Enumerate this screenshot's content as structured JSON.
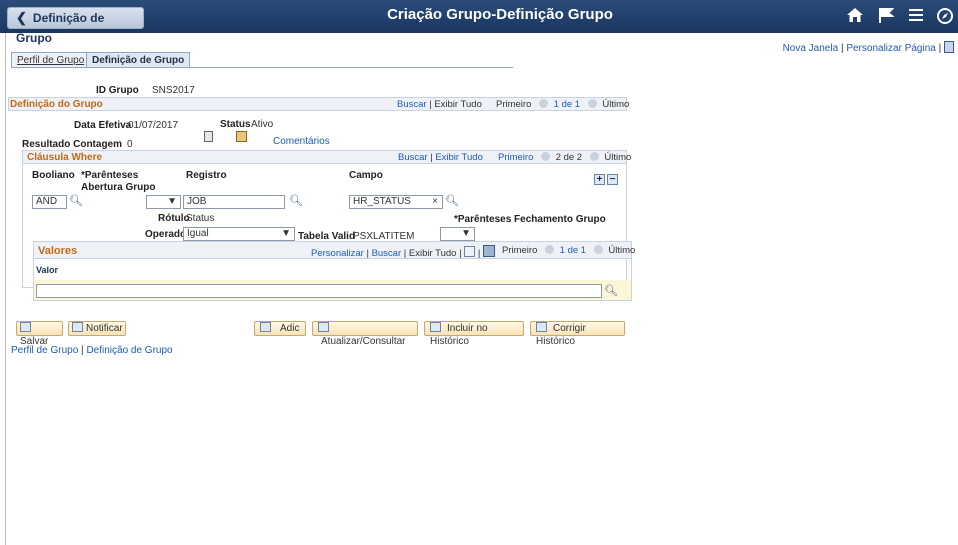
{
  "header": {
    "back_label": "Definição de Grupo",
    "title": "Criação Grupo-Definição Grupo",
    "icons": [
      "home-icon",
      "flag-icon",
      "menu-icon",
      "compass-icon"
    ]
  },
  "toplinks": {
    "new_window": "Nova Janela",
    "sep": "|",
    "personalize": "Personalizar Página",
    "sep2": "|"
  },
  "tabs": [
    {
      "label": "Perfil de Grupo",
      "active": false
    },
    {
      "label": "Definição de Grupo",
      "active": true
    }
  ],
  "group_id": {
    "label": "ID Grupo",
    "value": "SNS2017"
  },
  "group_def": {
    "title": "Definição do Grupo",
    "buscar": "Buscar",
    "exibir_tudo": "Exibir Tudo",
    "sep": "|",
    "primeiro": "Primeiro",
    "range": "1 de 1",
    "ultimo": "Último",
    "effective_date_label": "Data Efetiva",
    "effective_date": "01/07/2017",
    "status_label": "Status",
    "status": "Ativo",
    "count_label": "Resultado Contagem",
    "count": "0",
    "comments": "Comentários"
  },
  "where": {
    "title": "Cláusula Where",
    "buscar": "Buscar",
    "exibir_tudo": "Exibir Tudo",
    "sep": "|",
    "primeiro": "Primeiro",
    "range": "2 de 2",
    "ultimo": "Último",
    "col_booleano": "Booliano",
    "col_open": "*Parênteses Abertura Grupo",
    "col_registro": "Registro",
    "col_campo": "Campo",
    "booleano": "AND",
    "registro": "JOB",
    "campo": "HR_STATUS",
    "rotulo_label": "Rótulo",
    "rotulo": "Status",
    "close_label": "*Parênteses Fechamento Grupo",
    "operador_label": "Operador",
    "operador": "Igual",
    "tabela_label": "Tabela Valid",
    "tabela": "PSXLATITEM",
    "plus": "+",
    "minus": "−"
  },
  "valores": {
    "title": "Valores",
    "personalizar": "Personalizar",
    "buscar": "Buscar",
    "exibir_tudo": "Exibir Tudo",
    "sep": "|",
    "primeiro": "Primeiro",
    "range": "1 de 1",
    "ultimo": "Último",
    "col_valor": "Valor",
    "valor": ""
  },
  "buttons": {
    "salvar": "Salvar",
    "notificar": "Notificar",
    "adic": "Adic",
    "atualizar": "Atualizar/Consultar",
    "incluir": "Incluir no Histórico",
    "corrigir": "Corrigir Histórico"
  },
  "bottom_links": {
    "perfil": "Perfil de Grupo",
    "sep": "|",
    "definicao": "Definição de Grupo"
  }
}
